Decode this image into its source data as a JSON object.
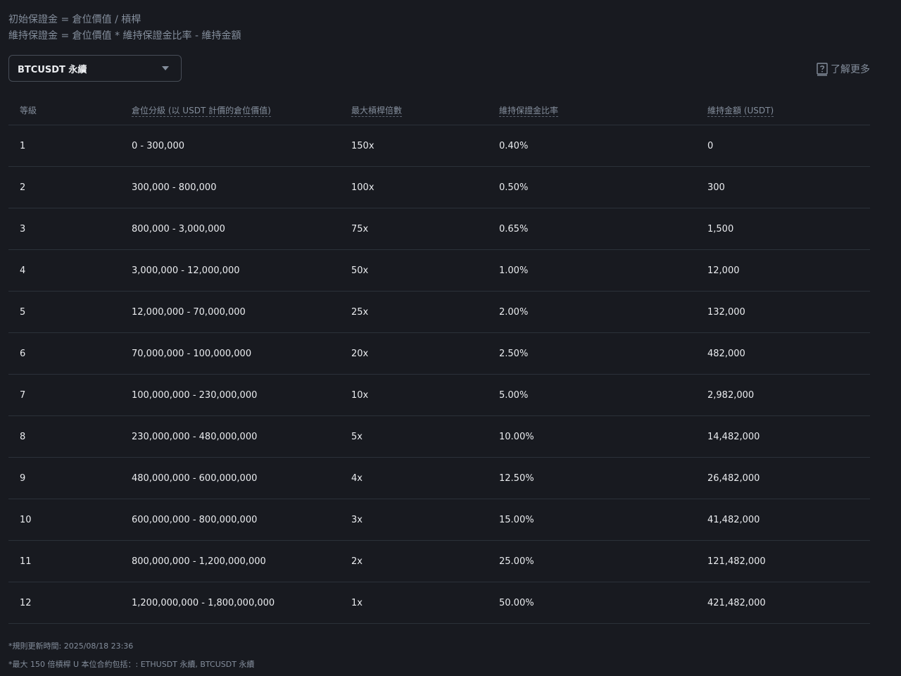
{
  "formulas": {
    "initial_margin": "初始保證金 = 倉位價值 / 槓桿",
    "maintenance_margin": "維持保證金 = 倉位價值 * 維持保證金比率 - 維持金額"
  },
  "symbol_select": {
    "value": "BTCUSDT 永續",
    "icon": "caret-down"
  },
  "learn_more": {
    "label": "了解更多",
    "icon": "help-box"
  },
  "table": {
    "headers": [
      "等級",
      "倉位分級 (以 USDT 計價的倉位價值)",
      "最大槓桿倍數",
      "維持保證金比率",
      "維持金額 (USDT)"
    ],
    "rows": [
      [
        "1",
        "0 - 300,000",
        "150x",
        "0.40%",
        "0"
      ],
      [
        "2",
        "300,000 - 800,000",
        "100x",
        "0.50%",
        "300"
      ],
      [
        "3",
        "800,000 - 3,000,000",
        "75x",
        "0.65%",
        "1,500"
      ],
      [
        "4",
        "3,000,000 - 12,000,000",
        "50x",
        "1.00%",
        "12,000"
      ],
      [
        "5",
        "12,000,000 - 70,000,000",
        "25x",
        "2.00%",
        "132,000"
      ],
      [
        "6",
        "70,000,000 - 100,000,000",
        "20x",
        "2.50%",
        "482,000"
      ],
      [
        "7",
        "100,000,000 - 230,000,000",
        "10x",
        "5.00%",
        "2,982,000"
      ],
      [
        "8",
        "230,000,000 - 480,000,000",
        "5x",
        "10.00%",
        "14,482,000"
      ],
      [
        "9",
        "480,000,000 - 600,000,000",
        "4x",
        "12.50%",
        "26,482,000"
      ],
      [
        "10",
        "600,000,000 - 800,000,000",
        "3x",
        "15.00%",
        "41,482,000"
      ],
      [
        "11",
        "800,000,000 - 1,200,000,000",
        "2x",
        "25.00%",
        "121,482,000"
      ],
      [
        "12",
        "1,200,000,000 - 1,800,000,000",
        "1x",
        "50.00%",
        "421,482,000"
      ]
    ]
  },
  "notes": {
    "updated": "*規則更新時間: 2025/08/18 23:36",
    "max_leverage": "*最大 150 倍槓桿 U 本位合約包括：: ETHUSDT 永續, BTCUSDT 永續"
  },
  "colors": {
    "background": "#181a20",
    "text_primary": "#eaecef",
    "text_secondary": "#848e9c",
    "divider": "#2b3139"
  }
}
